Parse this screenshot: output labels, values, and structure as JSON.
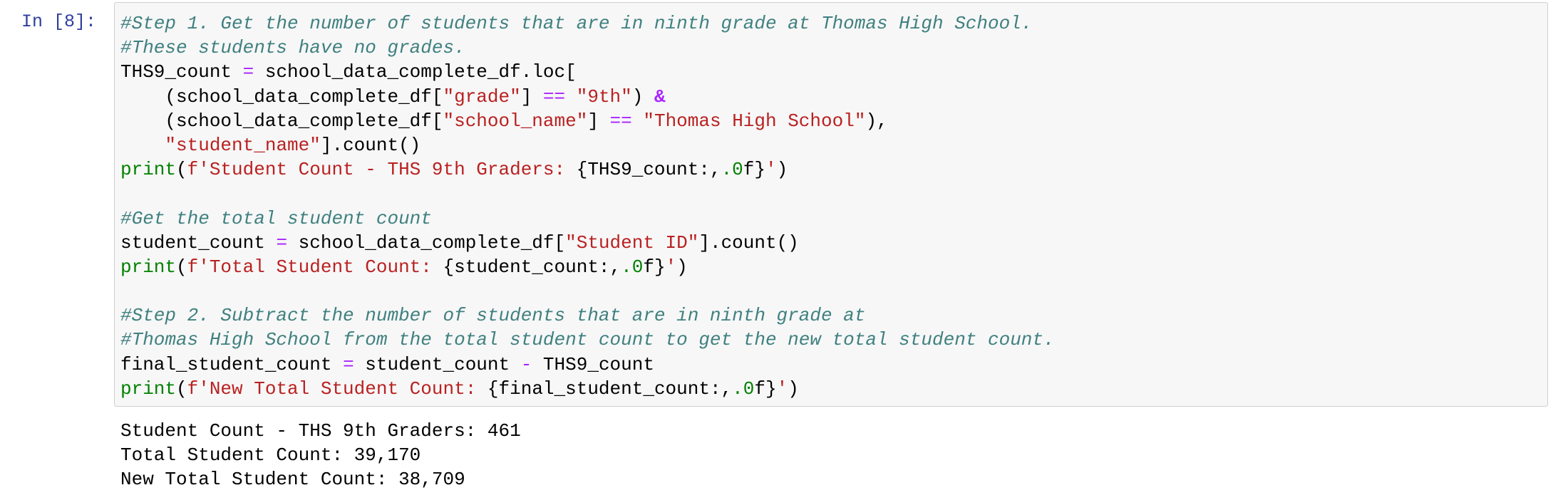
{
  "cell": {
    "prompt": "In [8]:",
    "code_lines": [
      [
        {
          "t": "c",
          "v": "#Step 1. Get the number of students that are in ninth grade at Thomas High School."
        }
      ],
      [
        {
          "t": "c",
          "v": "#These students have no grades."
        }
      ],
      [
        {
          "t": "n",
          "v": "THS9_count "
        },
        {
          "t": "o",
          "v": "="
        },
        {
          "t": "n",
          "v": " school_data_complete_df.loc["
        }
      ],
      [
        {
          "t": "n",
          "v": "    (school_data_complete_df["
        },
        {
          "t": "s",
          "v": "\"grade\""
        },
        {
          "t": "n",
          "v": "] "
        },
        {
          "t": "o",
          "v": "=="
        },
        {
          "t": "n",
          "v": " "
        },
        {
          "t": "s",
          "v": "\"9th\""
        },
        {
          "t": "n",
          "v": ") "
        },
        {
          "t": "ow",
          "v": "&"
        }
      ],
      [
        {
          "t": "n",
          "v": "    (school_data_complete_df["
        },
        {
          "t": "s",
          "v": "\"school_name\""
        },
        {
          "t": "n",
          "v": "] "
        },
        {
          "t": "o",
          "v": "=="
        },
        {
          "t": "n",
          "v": " "
        },
        {
          "t": "s",
          "v": "\"Thomas High School\""
        },
        {
          "t": "n",
          "v": "),"
        }
      ],
      [
        {
          "t": "n",
          "v": "    "
        },
        {
          "t": "s",
          "v": "\"student_name\""
        },
        {
          "t": "n",
          "v": "].count()"
        }
      ],
      [
        {
          "t": "nb",
          "v": "print"
        },
        {
          "t": "n",
          "v": "("
        },
        {
          "t": "s",
          "v": "f'Student Count - THS 9th Graders: "
        },
        {
          "t": "si",
          "v": "{THS9_count:,"
        },
        {
          "t": "num",
          "v": ".0"
        },
        {
          "t": "si",
          "v": "f}"
        },
        {
          "t": "s",
          "v": "'"
        },
        {
          "t": "n",
          "v": ")"
        }
      ],
      [],
      [
        {
          "t": "c",
          "v": "#Get the total student count"
        }
      ],
      [
        {
          "t": "n",
          "v": "student_count "
        },
        {
          "t": "o",
          "v": "="
        },
        {
          "t": "n",
          "v": " school_data_complete_df["
        },
        {
          "t": "s",
          "v": "\"Student ID\""
        },
        {
          "t": "n",
          "v": "].count()"
        }
      ],
      [
        {
          "t": "nb",
          "v": "print"
        },
        {
          "t": "n",
          "v": "("
        },
        {
          "t": "s",
          "v": "f'Total Student Count: "
        },
        {
          "t": "si",
          "v": "{student_count:,"
        },
        {
          "t": "num",
          "v": ".0"
        },
        {
          "t": "si",
          "v": "f}"
        },
        {
          "t": "s",
          "v": "'"
        },
        {
          "t": "n",
          "v": ")"
        }
      ],
      [],
      [
        {
          "t": "c",
          "v": "#Step 2. Subtract the number of students that are in ninth grade at"
        }
      ],
      [
        {
          "t": "c",
          "v": "#Thomas High School from the total student count to get the new total student count."
        }
      ],
      [
        {
          "t": "n",
          "v": "final_student_count "
        },
        {
          "t": "o",
          "v": "="
        },
        {
          "t": "n",
          "v": " student_count "
        },
        {
          "t": "o",
          "v": "-"
        },
        {
          "t": "n",
          "v": " THS9_count"
        }
      ],
      [
        {
          "t": "nb",
          "v": "print"
        },
        {
          "t": "n",
          "v": "("
        },
        {
          "t": "s",
          "v": "f'New Total Student Count: "
        },
        {
          "t": "si",
          "v": "{final_student_count:,"
        },
        {
          "t": "num",
          "v": ".0"
        },
        {
          "t": "si",
          "v": "f}"
        },
        {
          "t": "s",
          "v": "'"
        },
        {
          "t": "n",
          "v": ")"
        }
      ]
    ],
    "output_lines": [
      "Student Count - THS 9th Graders: 461",
      "Total Student Count: 39,170",
      "New Total Student Count: 38,709"
    ]
  }
}
